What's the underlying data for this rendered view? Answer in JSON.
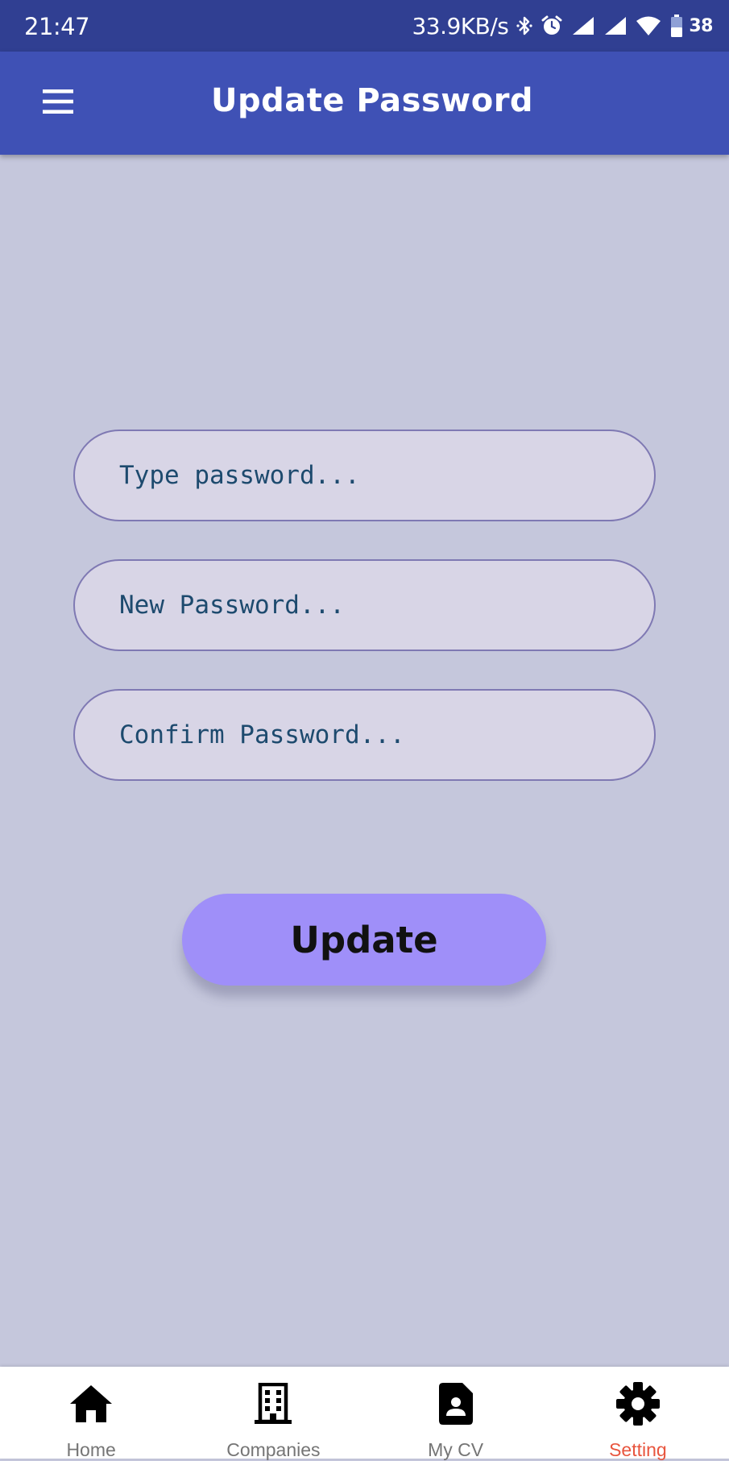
{
  "status_bar": {
    "time": "21:47",
    "network_speed": "33.9KB/s",
    "icons": [
      "bluetooth-icon",
      "alarm-icon",
      "signal-icon",
      "signal-icon",
      "wifi-icon",
      "battery-icon"
    ],
    "battery": "38"
  },
  "app_bar": {
    "menu_icon": "hamburger-menu-icon",
    "title": "Update Password"
  },
  "form": {
    "current_password": {
      "value": "",
      "placeholder": "Type password..."
    },
    "new_password": {
      "value": "",
      "placeholder": "New Password..."
    },
    "confirm_password": {
      "value": "",
      "placeholder": "Confirm Password..."
    },
    "submit_label": "Update"
  },
  "bottom_nav": {
    "items": [
      {
        "label": "Home",
        "icon": "home-icon",
        "active": false
      },
      {
        "label": "Companies",
        "icon": "building-icon",
        "active": false
      },
      {
        "label": "My CV",
        "icon": "cv-document-icon",
        "active": false
      },
      {
        "label": "Setting",
        "icon": "gear-icon",
        "active": true
      }
    ]
  },
  "colors": {
    "status_bar": "#303f92",
    "app_bar": "#3f51b5",
    "background": "#c5c7dc",
    "field_fill": "#d8d5e6",
    "field_border": "#7f79b3",
    "field_text": "#1d4a6e",
    "button": "#9f8ff9",
    "nav_active": "#e8553e",
    "nav_inactive": "#757575"
  }
}
